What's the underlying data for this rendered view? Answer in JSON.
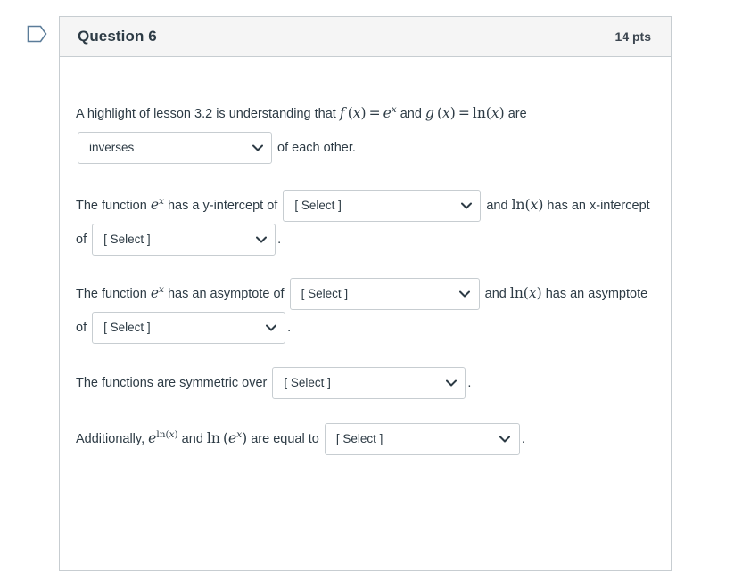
{
  "flag": {
    "icon": "flag-bookmark-icon"
  },
  "question": {
    "title": "Question 6",
    "points": "14 pts"
  },
  "blocks": [
    {
      "id": "inverses-block",
      "segments": [
        {
          "type": "text",
          "value": "A highlight of lesson 3.2 is understanding that "
        },
        {
          "type": "math",
          "value": "f (x) = e^x"
        },
        {
          "type": "text",
          "value": " and "
        },
        {
          "type": "math",
          "value": "g (x) = ln(x)"
        },
        {
          "type": "text",
          "value": " are "
        },
        {
          "type": "select",
          "value": "inverses"
        },
        {
          "type": "text",
          "value": " of each other."
        }
      ]
    },
    {
      "id": "intercept-block",
      "segments": [
        {
          "type": "text",
          "value": "The function "
        },
        {
          "type": "math",
          "value": "e^x"
        },
        {
          "type": "text",
          "value": " has a y-intercept of "
        },
        {
          "type": "select",
          "value": "[ Select ]"
        },
        {
          "type": "text",
          "value": " and "
        },
        {
          "type": "math",
          "value": "ln(x)"
        },
        {
          "type": "text",
          "value": " has an x-intercept of "
        },
        {
          "type": "select",
          "value": "[ Select ]"
        },
        {
          "type": "text",
          "value": " ."
        }
      ]
    },
    {
      "id": "asymptote-block",
      "segments": [
        {
          "type": "text",
          "value": "The function "
        },
        {
          "type": "math",
          "value": "e^x"
        },
        {
          "type": "text",
          "value": " has an asymptote of "
        },
        {
          "type": "select",
          "value": "[ Select ]"
        },
        {
          "type": "text",
          "value": " and "
        },
        {
          "type": "math",
          "value": "ln(x)"
        },
        {
          "type": "text",
          "value": " has an asymptote of "
        },
        {
          "type": "select",
          "value": "[ Select ]"
        },
        {
          "type": "text",
          "value": " ."
        }
      ]
    },
    {
      "id": "symmetry-block",
      "segments": [
        {
          "type": "text",
          "value": "The functions are symmetric over "
        },
        {
          "type": "select",
          "value": "[ Select ]"
        },
        {
          "type": "text",
          "value": " ."
        }
      ]
    },
    {
      "id": "additionally-block",
      "segments": [
        {
          "type": "text",
          "value": "Additionally, "
        },
        {
          "type": "math",
          "value": "e^{ln(x)}"
        },
        {
          "type": "text",
          "value": " and "
        },
        {
          "type": "math",
          "value": "ln(e^x)"
        },
        {
          "type": "text",
          "value": " are equal to "
        },
        {
          "type": "select",
          "value": "[ Select ]"
        },
        {
          "type": "text",
          "value": " ."
        }
      ]
    }
  ],
  "text": {
    "l1_part1": "A highlight of lesson 3.2 is understanding that ",
    "l1_and": " and ",
    "l1_are": " are ",
    "l1_of_each_other": " of each other.",
    "l2_the_function": "The function ",
    "l2_has_y_int": " has a y-intercept of ",
    "l2_and": " and ",
    "l2_has_x_int": " has an x-intercept of ",
    "l3_the_function": "The function ",
    "l3_has_asym": " has an asymptote of ",
    "l3_and": " and ",
    "l3_has_asym2": " has an asymptote of ",
    "l4_symmetric": "The functions are symmetric over ",
    "l5_additionally": "Additionally, ",
    "l5_and": " and ",
    "l5_equal_to": " are equal to ",
    "period": "."
  },
  "selects": {
    "inverses": {
      "value": "inverses",
      "placeholder": "[ Select ]"
    },
    "y_intercept": {
      "value": "[ Select ]"
    },
    "x_intercept": {
      "value": "[ Select ]"
    },
    "asymptote_exp": {
      "value": "[ Select ]"
    },
    "asymptote_ln": {
      "value": "[ Select ]"
    },
    "symmetry": {
      "value": "[ Select ]"
    },
    "additionally": {
      "value": "[ Select ]"
    }
  },
  "colors": {
    "card_border": "#c7cdd1",
    "header_bg": "#f5f5f5",
    "text": "#2d3b45",
    "flag_icon": "#5b7c99",
    "select_border": "#c7cdd1"
  }
}
